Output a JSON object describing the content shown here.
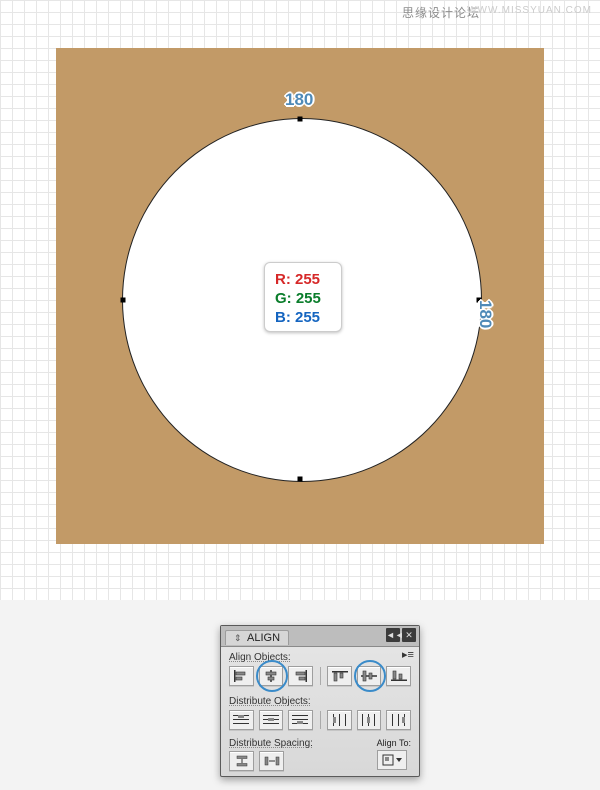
{
  "watermark": {
    "text1": "思缘设计论坛",
    "text2": "WWW.MISSYUAN.COM"
  },
  "canvas": {
    "artboard_fill": "#c29a67",
    "circle_fill": "#ffffff",
    "dimensions": {
      "top": "180",
      "right": "180"
    },
    "rgb": {
      "r_label": "R: 255",
      "g_label": "G: 255",
      "b_label": "B: 255",
      "r": 255,
      "g": 255,
      "b": 255
    }
  },
  "align_panel": {
    "title": "ALIGN",
    "collapse_glyph": "◄◄",
    "close_glyph": "✕",
    "menu_glyph": "▸≡",
    "sections": {
      "align_objects": {
        "label": "Align Objects:",
        "buttons": [
          {
            "name": "align-left"
          },
          {
            "name": "align-hcenter",
            "highlight": true
          },
          {
            "name": "align-right"
          },
          {
            "name": "align-top"
          },
          {
            "name": "align-vcenter",
            "highlight": true
          },
          {
            "name": "align-bottom"
          }
        ]
      },
      "distribute_objects": {
        "label": "Distribute Objects:",
        "buttons": [
          {
            "name": "dist-top"
          },
          {
            "name": "dist-vcenter"
          },
          {
            "name": "dist-bottom"
          },
          {
            "name": "dist-left"
          },
          {
            "name": "dist-hcenter"
          },
          {
            "name": "dist-right"
          }
        ]
      },
      "distribute_spacing": {
        "label": "Distribute Spacing:",
        "buttons": [
          {
            "name": "dist-space-v"
          },
          {
            "name": "dist-space-h"
          }
        ]
      },
      "align_to": {
        "label": "Align To:"
      }
    }
  }
}
